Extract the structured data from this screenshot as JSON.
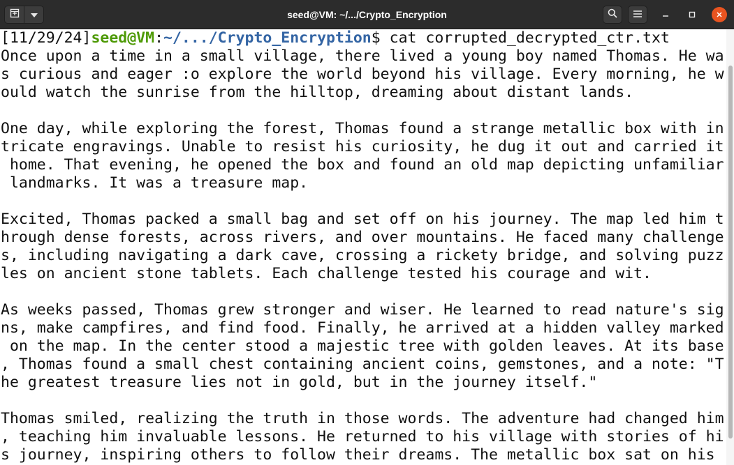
{
  "window": {
    "title": "seed@VM: ~/.../Crypto_Encryption",
    "icons": {
      "new_tab": "new-tab-icon",
      "dropdown": "chevron-down-icon",
      "search": "search-icon",
      "menu": "hamburger-menu-icon",
      "minimize": "minimize-icon",
      "maximize": "maximize-icon",
      "close": "close-icon"
    },
    "colors": {
      "titlebar": "#2c2c2c",
      "close_button": "#e95420",
      "prompt_user": "#4e9a06",
      "prompt_path": "#3465a4"
    }
  },
  "terminal": {
    "prompt": {
      "timestamp": "[11/29/24]",
      "user_host": "seed@VM",
      "separator": ":",
      "path": "~/.../Crypto_Encryption",
      "symbol": "$",
      "command": " cat corrupted_decrypted_ctr.txt"
    },
    "lines": [
      "Once upon a time in a small village, there lived a young boy named Thomas. He wa",
      "s curious and eager :o explore the world beyond his village. Every morning, he w",
      "ould watch the sunrise from the hilltop, dreaming about distant lands.",
      "",
      "One day, while exploring the forest, Thomas found a strange metallic box with in",
      "tricate engravings. Unable to resist his curiosity, he dug it out and carried it",
      " home. That evening, he opened the box and found an old map depicting unfamiliar",
      " landmarks. It was a treasure map.",
      "",
      "Excited, Thomas packed a small bag and set off on his journey. The map led him t",
      "hrough dense forests, across rivers, and over mountains. He faced many challenge",
      "s, including navigating a dark cave, crossing a rickety bridge, and solving puzz",
      "les on ancient stone tablets. Each challenge tested his courage and wit.",
      "",
      "As weeks passed, Thomas grew stronger and wiser. He learned to read nature's sig",
      "ns, make campfires, and find food. Finally, he arrived at a hidden valley marked",
      " on the map. In the center stood a majestic tree with golden leaves. At its base",
      ", Thomas found a small chest containing ancient coins, gemstones, and a note: \"T",
      "he greatest treasure lies not in gold, but in the journey itself.\"",
      "",
      "Thomas smiled, realizing the truth in those words. The adventure had changed him",
      ", teaching him invaluable lessons. He returned to his village with stories of hi",
      "s journey, inspiring others to follow their dreams. The metallic box sat on his "
    ]
  }
}
